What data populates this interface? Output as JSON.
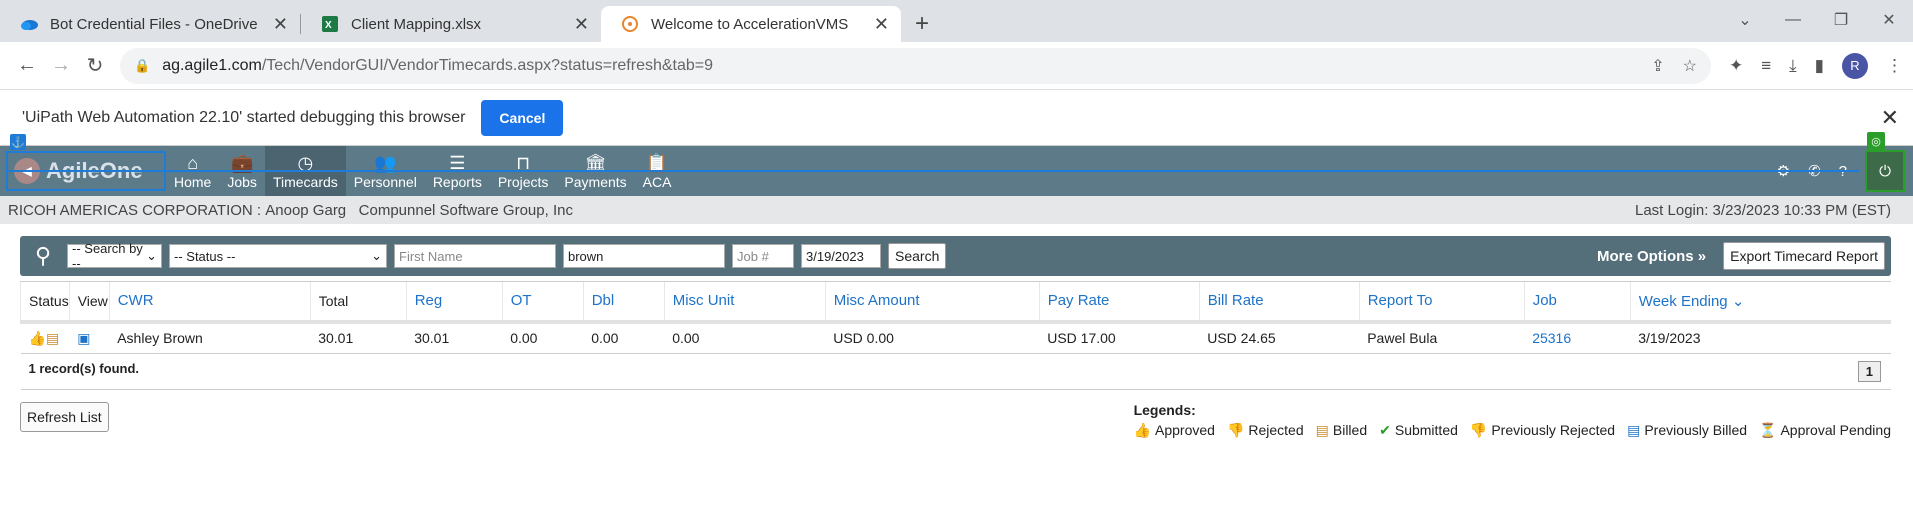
{
  "browser": {
    "tabs": [
      {
        "title": "Bot Credential Files - OneDrive",
        "icon": "onedrive-icon"
      },
      {
        "title": "Client Mapping.xlsx",
        "icon": "excel-icon"
      },
      {
        "title": "Welcome to AccelerationVMS",
        "icon": "accelerationvms-icon"
      }
    ],
    "url_host": "ag.agile1.com",
    "url_path": "/Tech/VendorGUI/VendorTimecards.aspx?status=refresh&tab=9",
    "avatar_letter": "R"
  },
  "infobar": {
    "message": "'UiPath Web Automation 22.10' started debugging this browser",
    "cancel_label": "Cancel"
  },
  "app": {
    "logo_text": "AgileOne",
    "nav": [
      "Home",
      "Jobs",
      "Timecards",
      "Personnel",
      "Reports",
      "Projects",
      "Payments",
      "ACA"
    ],
    "active_nav": "Timecards"
  },
  "subbar": {
    "company": "RICOH AMERICAS CORPORATION :",
    "user": "Anoop Garg",
    "vendor": "Compunnel Software Group, Inc",
    "last_login": "Last Login: 3/23/2023 10:33 PM (EST)"
  },
  "search": {
    "search_by": "-- Search by --",
    "status": "-- Status --",
    "first_name_placeholder": "First Name",
    "last_name_value": "brown",
    "job_placeholder": "Job #",
    "date_value": "3/19/2023",
    "search_label": "Search",
    "more_options": "More Options »",
    "export_label": "Export Timecard Report"
  },
  "table": {
    "headers": [
      "Status",
      "View",
      "CWR",
      "Total",
      "Reg",
      "OT",
      "Dbl",
      "Misc Unit",
      "Misc Amount",
      "Pay Rate",
      "Bill Rate",
      "Report To",
      "Job",
      "Week Ending ⌄"
    ],
    "row": {
      "cwr": "Ashley Brown",
      "total": "30.01",
      "reg": "30.01",
      "ot": "0.00",
      "dbl": "0.00",
      "misc_unit": "0.00",
      "misc_amount": "USD 0.00",
      "pay_rate": "USD 17.00",
      "bill_rate": "USD 24.65",
      "report_to": "Pawel Bula",
      "job": "25316",
      "week_ending": "3/19/2023"
    },
    "records_found": "1 record(s) found.",
    "page": "1"
  },
  "refresh_label": "Refresh List",
  "legends": {
    "title": "Legends:",
    "items": [
      "Approved",
      "Rejected",
      "Billed",
      "Submitted",
      "Previously Rejected",
      "Previously Billed",
      "Approval Pending"
    ]
  }
}
